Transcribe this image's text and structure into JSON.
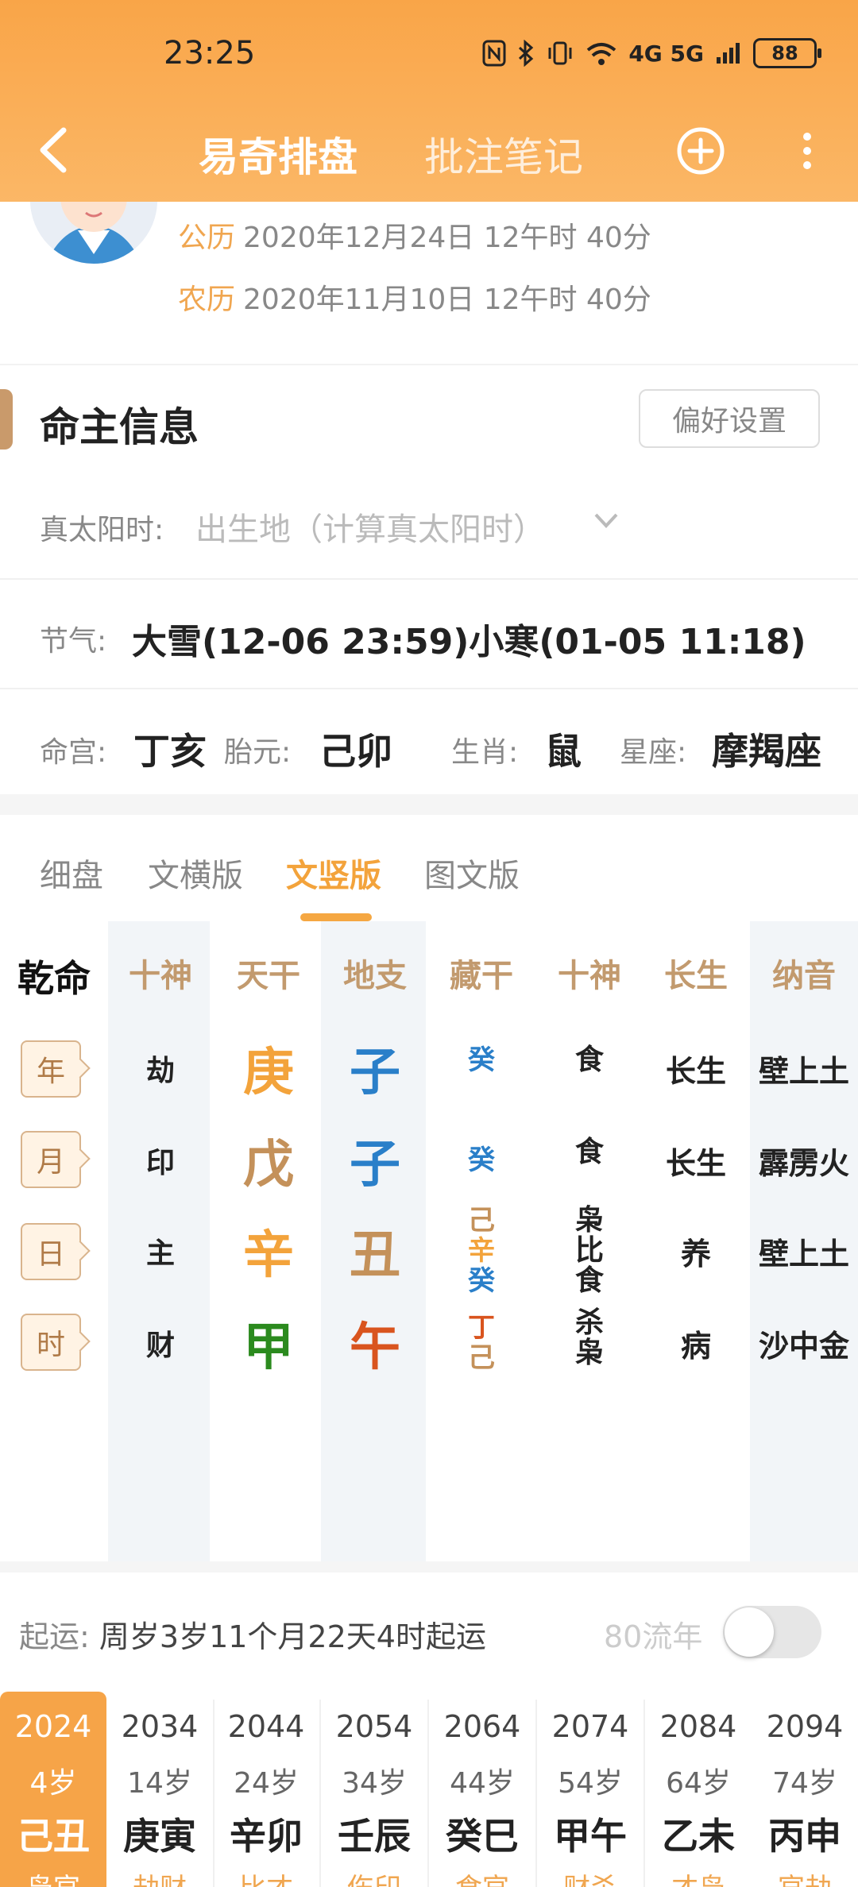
{
  "status": {
    "time": "23:25",
    "network": "4G 5G",
    "battery": "88"
  },
  "nav": {
    "tab_active": "易奇排盘",
    "tab_inactive": "批注笔记"
  },
  "dates": {
    "solar_label": "公历",
    "solar_value": "2020年12月24日 12午时 40分",
    "lunar_label": "农历",
    "lunar_value": "2020年11月10日 12午时 40分"
  },
  "section": {
    "title": "命主信息",
    "pref_button": "偏好设置"
  },
  "solar_time": {
    "label": "真太阳时:",
    "placeholder": "出生地（计算真太阳时）"
  },
  "jieqi": {
    "label": "节气:",
    "value": "大雪(12-06 23:59)小寒(01-05 11:18)"
  },
  "misc": {
    "minggong_label": "命宫:",
    "minggong_value": "丁亥",
    "taiyuan_label": "胎元:",
    "taiyuan_value": "己卯",
    "shengxiao_label": "生肖:",
    "shengxiao_value": "鼠",
    "xingzuo_label": "星座:",
    "xingzuo_value": "摩羯座"
  },
  "tabs": [
    "细盘",
    "文横版",
    "文竖版",
    "图文版"
  ],
  "active_tab": "文竖版",
  "table": {
    "headers": [
      "乾命",
      "十神",
      "天干",
      "地支",
      "藏干",
      "十神",
      "长生",
      "纳音"
    ],
    "rows": [
      {
        "pillar": "年",
        "shishen": "劫",
        "gan": "庚",
        "zhi": "子",
        "cang": [
          "癸"
        ],
        "shishen2": [
          "食"
        ],
        "changsheng": "长生",
        "nayin": "壁上土"
      },
      {
        "pillar": "月",
        "shishen": "印",
        "gan": "戊",
        "zhi": "子",
        "cang": [
          "癸"
        ],
        "shishen2": [
          "食"
        ],
        "changsheng": "长生",
        "nayin": "霹雳火"
      },
      {
        "pillar": "日",
        "shishen": "主",
        "gan": "辛",
        "zhi": "丑",
        "cang": [
          "己",
          "辛",
          "癸"
        ],
        "shishen2": [
          "枭",
          "比",
          "食"
        ],
        "changsheng": "养",
        "nayin": "壁上土"
      },
      {
        "pillar": "时",
        "shishen": "财",
        "gan": "甲",
        "zhi": "午",
        "cang": [
          "丁",
          "己"
        ],
        "shishen2": [
          "杀",
          "枭"
        ],
        "changsheng": "病",
        "nayin": "沙中金"
      }
    ],
    "colors": {
      "fire": "#d9541e",
      "earth": "#c4915a",
      "metal": "#f3a33b",
      "water": "#2a7fc9",
      "wood": "#2b8a1e"
    }
  },
  "qiyun": {
    "label": "起运:",
    "value": "周岁3岁11个月22天4时起运",
    "liunian_label": "80流年"
  },
  "dayun": [
    {
      "year": "2024",
      "age": "4岁",
      "ganzhi": "己丑",
      "shishen": "枭官"
    },
    {
      "year": "2034",
      "age": "14岁",
      "ganzhi": "庚寅",
      "shishen": "劫财"
    },
    {
      "year": "2044",
      "age": "24岁",
      "ganzhi": "辛卯",
      "shishen": "比才"
    },
    {
      "year": "2054",
      "age": "34岁",
      "ganzhi": "壬辰",
      "shishen": "伤印"
    },
    {
      "year": "2064",
      "age": "44岁",
      "ganzhi": "癸巳",
      "shishen": "食官"
    },
    {
      "year": "2074",
      "age": "54岁",
      "ganzhi": "甲午",
      "shishen": "财杀"
    },
    {
      "year": "2084",
      "age": "64岁",
      "ganzhi": "乙未",
      "shishen": "才枭"
    },
    {
      "year": "2094",
      "age": "74岁",
      "ganzhi": "丙申",
      "shishen": "官劫"
    }
  ]
}
